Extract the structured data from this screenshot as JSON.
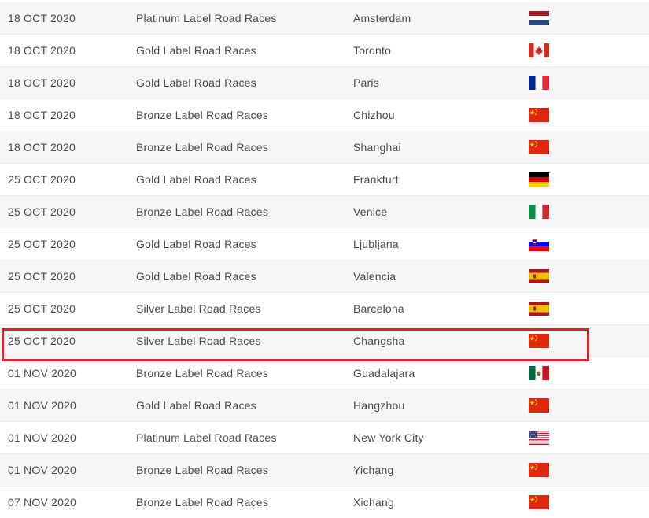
{
  "events": [
    {
      "date": "18 OCT 2020",
      "category": "Platinum Label Road Races",
      "city": "Amsterdam",
      "flag": "nl"
    },
    {
      "date": "18 OCT 2020",
      "category": "Gold Label Road Races",
      "city": "Toronto",
      "flag": "ca"
    },
    {
      "date": "18 OCT 2020",
      "category": "Gold Label Road Races",
      "city": "Paris",
      "flag": "fr"
    },
    {
      "date": "18 OCT 2020",
      "category": "Bronze Label Road Races",
      "city": "Chizhou",
      "flag": "cn"
    },
    {
      "date": "18 OCT 2020",
      "category": "Bronze Label Road Races",
      "city": "Shanghai",
      "flag": "cn"
    },
    {
      "date": "25 OCT 2020",
      "category": "Gold Label Road Races",
      "city": "Frankfurt",
      "flag": "de"
    },
    {
      "date": "25 OCT 2020",
      "category": "Bronze Label Road Races",
      "city": "Venice",
      "flag": "it"
    },
    {
      "date": "25 OCT 2020",
      "category": "Gold Label Road Races",
      "city": "Ljubljana",
      "flag": "si"
    },
    {
      "date": "25 OCT 2020",
      "category": "Gold Label Road Races",
      "city": "Valencia",
      "flag": "es"
    },
    {
      "date": "25 OCT 2020",
      "category": "Silver Label Road Races",
      "city": "Barcelona",
      "flag": "es"
    },
    {
      "date": "25 OCT 2020",
      "category": "Silver Label Road Races",
      "city": "Changsha",
      "flag": "cn",
      "highlighted": true
    },
    {
      "date": "01 NOV 2020",
      "category": "Bronze Label Road Races",
      "city": "Guadalajara",
      "flag": "mx"
    },
    {
      "date": "01 NOV 2020",
      "category": "Gold Label Road Races",
      "city": "Hangzhou",
      "flag": "cn"
    },
    {
      "date": "01 NOV 2020",
      "category": "Platinum Label Road Races",
      "city": "New York City",
      "flag": "us"
    },
    {
      "date": "01 NOV 2020",
      "category": "Bronze Label Road Races",
      "city": "Yichang",
      "flag": "cn"
    },
    {
      "date": "07 NOV 2020",
      "category": "Bronze Label Road Races",
      "city": "Xichang",
      "flag": "cn"
    }
  ],
  "colors": {
    "text": "#4a4a4a",
    "row_alt": "#f6f6f6",
    "highlight": "#d9232d"
  }
}
